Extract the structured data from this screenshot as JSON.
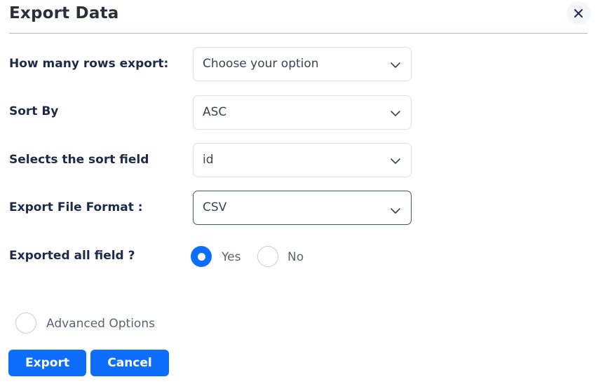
{
  "dialog": {
    "title": "Export Data",
    "close_label": "×"
  },
  "form": {
    "rows": {
      "label": "How many rows export:",
      "value": "Choose your option"
    },
    "sort_by": {
      "label": "Sort By",
      "value": "ASC"
    },
    "sort_field": {
      "label": "Selects the sort field",
      "value": "id"
    },
    "file_format": {
      "label": "Export File Format :",
      "value": "CSV"
    },
    "all_fields": {
      "label": "Exported all field ?",
      "options": [
        "Yes",
        "No"
      ],
      "selected": "Yes"
    },
    "advanced": {
      "label": "Advanced Options",
      "checked": false
    }
  },
  "actions": {
    "export_label": "Export",
    "cancel_label": "Cancel"
  },
  "colors": {
    "primary": "#0d6efd",
    "label_text": "#1e2a4a",
    "divider": "#aab8d6"
  },
  "icons": {
    "close": "close-icon",
    "dropdown": "chevron-down-icon"
  }
}
